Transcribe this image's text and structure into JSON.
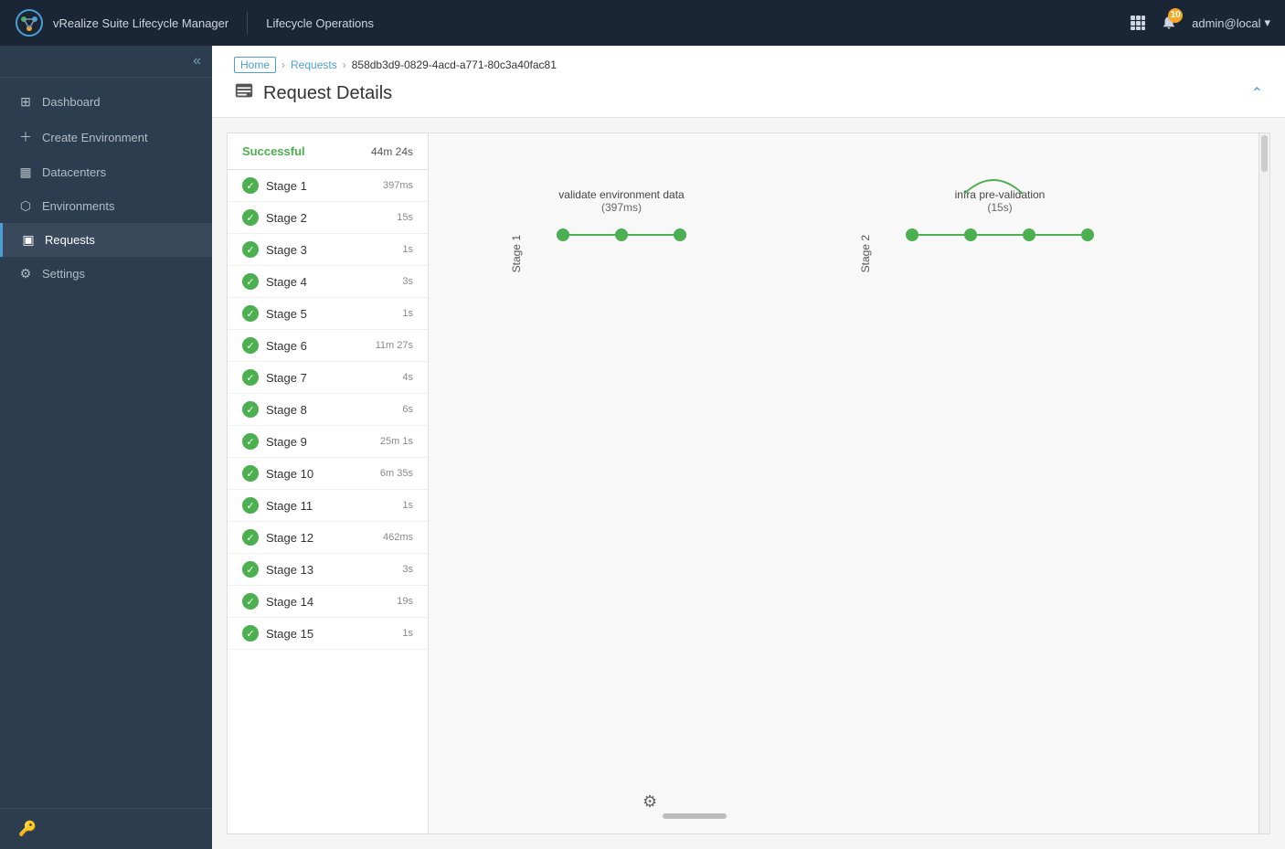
{
  "app": {
    "title": "vRealize Suite Lifecycle Manager",
    "section": "Lifecycle Operations",
    "user": "admin@local",
    "bell_count": "10"
  },
  "breadcrumb": {
    "home": "Home",
    "requests": "Requests",
    "request_id": "858db3d9-0829-4acd-a771-80c3a40fac81"
  },
  "page": {
    "title": "Request Details"
  },
  "stages_panel": {
    "status": "Successful",
    "duration": "44m 24s"
  },
  "stages": [
    {
      "name": "Stage 1",
      "duration": "397ms"
    },
    {
      "name": "Stage 2",
      "duration": "15s"
    },
    {
      "name": "Stage 3",
      "duration": "1s"
    },
    {
      "name": "Stage 4",
      "duration": "3s"
    },
    {
      "name": "Stage 5",
      "duration": "1s"
    },
    {
      "name": "Stage 6",
      "duration": "11m 27s"
    },
    {
      "name": "Stage 7",
      "duration": "4s"
    },
    {
      "name": "Stage 8",
      "duration": "6s"
    },
    {
      "name": "Stage 9",
      "duration": "25m 1s"
    },
    {
      "name": "Stage 10",
      "duration": "6m 35s"
    },
    {
      "name": "Stage 11",
      "duration": "1s"
    },
    {
      "name": "Stage 12",
      "duration": "462ms"
    },
    {
      "name": "Stage 13",
      "duration": "3s"
    },
    {
      "name": "Stage 14",
      "duration": "19s"
    },
    {
      "name": "Stage 15",
      "duration": "1s"
    }
  ],
  "diagram": {
    "stage1": {
      "label": "Stage 1",
      "task_name": "validate environment data",
      "task_duration": "(397ms)"
    },
    "stage2": {
      "label": "Stage 2",
      "task_name": "infra pre-validation",
      "task_duration": "(15s)"
    }
  },
  "sidebar": {
    "items": [
      {
        "label": "Dashboard",
        "icon": "⊞"
      },
      {
        "label": "Create Environment",
        "icon": "＋"
      },
      {
        "label": "Datacenters",
        "icon": "▦"
      },
      {
        "label": "Environments",
        "icon": "⬡"
      },
      {
        "label": "Requests",
        "icon": "▣"
      },
      {
        "label": "Settings",
        "icon": "⚙"
      }
    ]
  }
}
